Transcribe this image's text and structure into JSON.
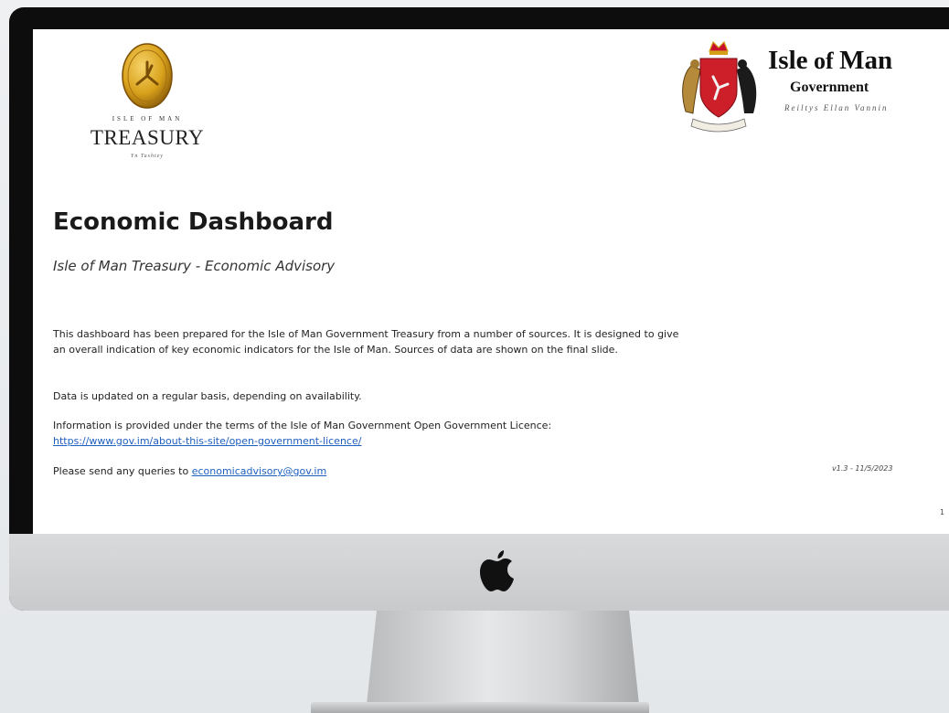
{
  "treasury_logo": {
    "top_text": "ISLE OF MAN",
    "word": "TREASURY",
    "sub_text": "Yn Tashtey"
  },
  "iom_logo": {
    "title_a": "Isle",
    "title_b": " of ",
    "title_c": "Man",
    "government": "Government",
    "subtitle": "Reiltys Ellan Vannin"
  },
  "slide": {
    "title": "Economic Dashboard",
    "subtitle": "Isle of Man Treasury - Economic Advisory",
    "para1": "This dashboard has been prepared for the Isle of Man Government Treasury from a number of sources. It is designed to give an overall indication of key economic indicators for the Isle of Man. Sources of data are shown on the final slide.",
    "para2": "Data is updated on a regular basis, depending on availability.",
    "para3": "Information is provided under the terms of the Isle of Man Government Open Government Licence:",
    "licence_link": "https://www.gov.im/about-this-site/open-government-licence/",
    "para4_prefix": "Please send any queries to ",
    "email_link": "economicadvisory@gov.im",
    "version": "v1.3 - 11/5/2023",
    "page_number": "1"
  },
  "colors": {
    "link": "#1f5fbf",
    "monitor_bezel": "#0d0d0d",
    "chin": "#d1d2d4",
    "coin_gold": "#d9a21c",
    "crest_red": "#cc1f2a"
  },
  "icons": {
    "coin": "treasury-coin-icon",
    "crest": "iom-coat-of-arms-icon",
    "apple": "apple-logo-icon"
  }
}
